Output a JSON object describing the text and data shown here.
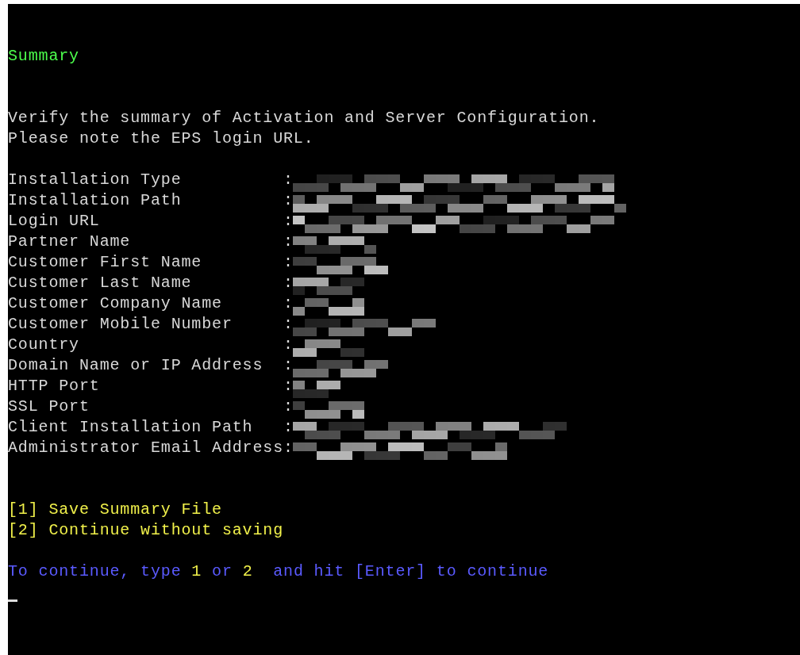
{
  "heading": "Summary",
  "intro": [
    "Verify the summary of Activation and Server Configuration.",
    "Please note the EPS login URL."
  ],
  "fields": [
    {
      "label": "Installation Type"
    },
    {
      "label": "Installation Path"
    },
    {
      "label": "Login URL"
    },
    {
      "label": "Partner Name"
    },
    {
      "label": "Customer First Name"
    },
    {
      "label": "Customer Last Name"
    },
    {
      "label": "Customer Company Name"
    },
    {
      "label": "Customer Mobile Number"
    },
    {
      "label": "Country"
    },
    {
      "label": "Domain Name or IP Address"
    },
    {
      "label": "HTTP Port"
    },
    {
      "label": "SSL Port"
    },
    {
      "label": "Client Installation Path"
    },
    {
      "label": "Administrator Email Address"
    }
  ],
  "separator": ":",
  "options": [
    "[1] Save Summary File",
    "[2] Continue without saving"
  ],
  "prompt": [
    {
      "kind": "text",
      "text": "To continue, type "
    },
    {
      "kind": "key",
      "text": "1"
    },
    {
      "kind": "text",
      "text": " or "
    },
    {
      "kind": "key",
      "text": "2"
    },
    {
      "kind": "text",
      "text": "  and hit [Enter] to continue"
    }
  ]
}
